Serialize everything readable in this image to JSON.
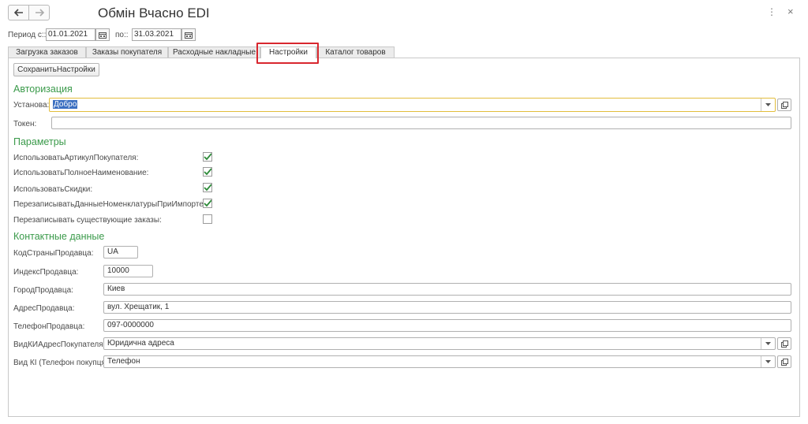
{
  "window": {
    "title": "Обмін Вчасно EDI",
    "menu_glyph": "⋮",
    "close_glyph": "×"
  },
  "period": {
    "from_label": "Период с::",
    "from_value": "01.01.2021",
    "to_label": "по::",
    "to_value": "31.03.2021"
  },
  "tabs": [
    {
      "label": "Загрузка заказов"
    },
    {
      "label": "Заказы покупателя"
    },
    {
      "label": "Расходные накладные"
    },
    {
      "label": "Настройки"
    },
    {
      "label": "Каталог товаров"
    }
  ],
  "toolbar": {
    "save_label": "СохранитьНастройки"
  },
  "auth": {
    "section_title": "Авторизация",
    "install_label": "Установа:",
    "install_value": "Добро",
    "token_label": "Токен:",
    "token_value": ""
  },
  "params": {
    "section_title": "Параметры",
    "items": [
      {
        "label": "ИспользоватьАртикулПокупателя:",
        "checked": true
      },
      {
        "label": "ИспользоватьПолноеНаименование:",
        "checked": true
      },
      {
        "label": "ИспользоватьСкидки:",
        "checked": true
      },
      {
        "label": "ПерезаписыватьДанныеНоменклатурыПриИмпорте:",
        "checked": true
      },
      {
        "label": "Перезаписывать существующие заказы:",
        "checked": false
      }
    ]
  },
  "contacts": {
    "section_title": "Контактные данные",
    "country_label": "КодСтраныПродавца:",
    "country_value": "UA",
    "index_label": "ИндексПродавца:",
    "index_value": "10000",
    "city_label": "ГородПродавца:",
    "city_value": "Киев",
    "address_label": "АдресПродавца:",
    "address_value": "вул. Хрещатик, 1",
    "phone_label": "ТелефонПродавца:",
    "phone_value": "097-0000000",
    "addr_kind_label": "ВидКИАдресПокупателя:",
    "addr_kind_value": "Юридична адреса",
    "phone_kind_label": "Вид КІ (Телефон покупця):",
    "phone_kind_value": "Телефон"
  },
  "colors": {
    "section_green": "#3a9a4a",
    "check_green": "#2e8b3a",
    "highlight_red": "#d8272f",
    "focus_yellow": "#e2bd3c"
  }
}
